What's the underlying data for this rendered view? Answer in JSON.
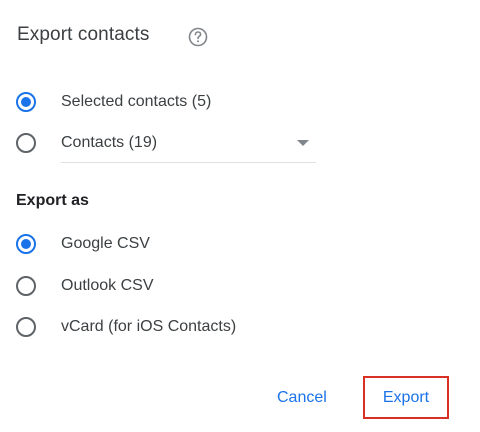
{
  "dialog": {
    "title": "Export contacts",
    "help_icon": "help-circle-icon"
  },
  "export_scope": {
    "options": [
      {
        "label": "Selected contacts (5)",
        "checked": true
      },
      {
        "label": "Contacts (19)",
        "checked": false,
        "has_dropdown": true
      }
    ]
  },
  "export_format": {
    "heading": "Export as",
    "options": [
      {
        "label": "Google CSV",
        "checked": true
      },
      {
        "label": "Outlook CSV",
        "checked": false
      },
      {
        "label": "vCard (for iOS Contacts)",
        "checked": false
      }
    ]
  },
  "actions": {
    "cancel_label": "Cancel",
    "export_label": "Export"
  },
  "colors": {
    "accent": "#1a73e8",
    "highlight_border": "#d93025",
    "radio_unchecked": "#5f6368"
  }
}
